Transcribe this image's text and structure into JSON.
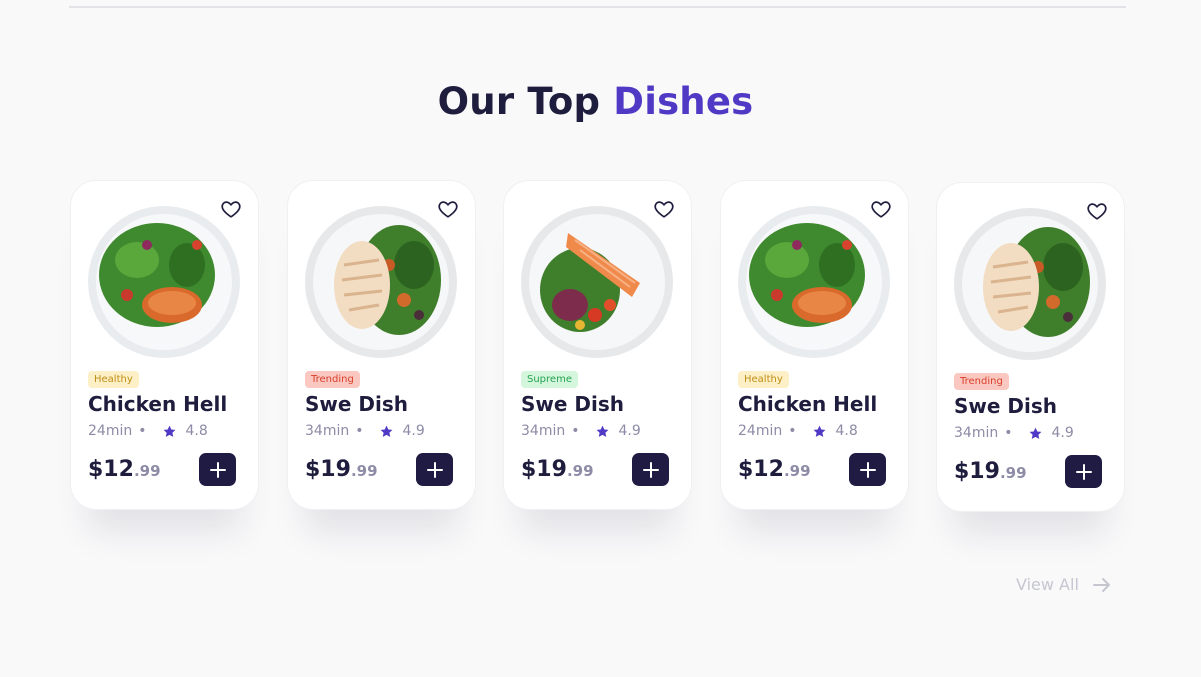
{
  "section": {
    "title_main": "Our Top ",
    "title_accent": "Dishes"
  },
  "colors": {
    "accent": "#4f39c5",
    "dark": "#1f1d3d",
    "button": "#1f1b43",
    "muted": "#8d8ba5"
  },
  "dishes": [
    {
      "tag": "Healthy",
      "tag_type": "healthy",
      "name": "Chicken Hell",
      "time": "24min",
      "rating": "4.8",
      "price_main": "$12",
      "price_cents": ".99",
      "image": "salmon-salad-plate"
    },
    {
      "tag": "Trending",
      "tag_type": "trending",
      "name": "Swe Dish",
      "time": "34min",
      "rating": "4.9",
      "price_main": "$19",
      "price_cents": ".99",
      "image": "chicken-salad-plate"
    },
    {
      "tag": "Supreme",
      "tag_type": "supreme",
      "name": "Swe Dish",
      "time": "34min",
      "rating": "4.9",
      "price_main": "$19",
      "price_cents": ".99",
      "image": "salmon-fillet-salad-plate"
    },
    {
      "tag": "Healthy",
      "tag_type": "healthy",
      "name": "Chicken Hell",
      "time": "24min",
      "rating": "4.8",
      "price_main": "$12",
      "price_cents": ".99",
      "image": "salmon-salad-plate"
    },
    {
      "tag": "Trending",
      "tag_type": "trending",
      "name": "Swe Dish",
      "time": "34min",
      "rating": "4.9",
      "price_main": "$19",
      "price_cents": ".99",
      "image": "chicken-salad-plate"
    }
  ],
  "view_all": {
    "label": "View All",
    "icon": "arrow-right-icon"
  }
}
